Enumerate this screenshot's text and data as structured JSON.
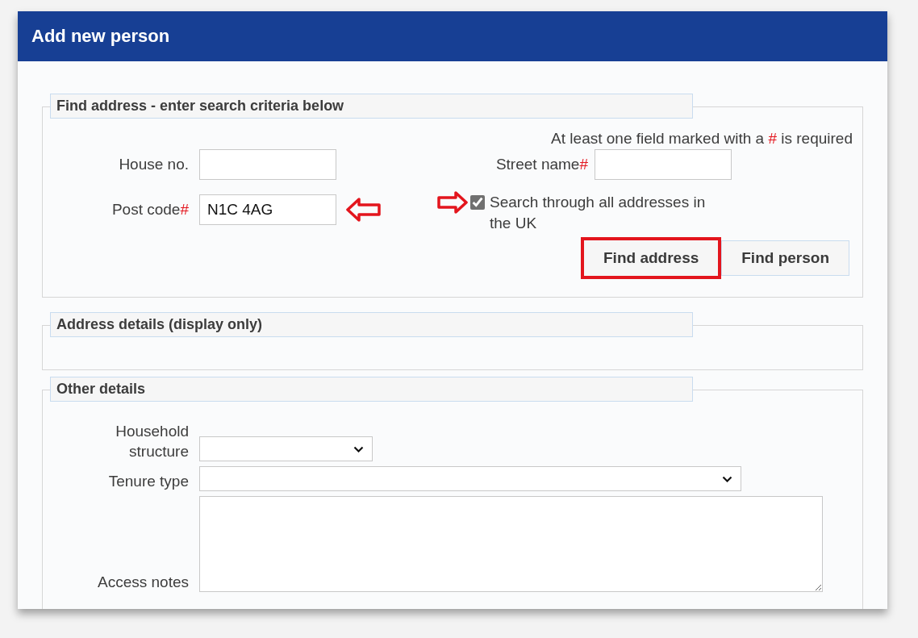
{
  "dialog": {
    "title": "Add new person"
  },
  "find_address": {
    "legend": "Find address - enter search criteria below",
    "note": {
      "before": "At least one field marked with a",
      "mark": "#",
      "after": "is required"
    },
    "house_no": {
      "label": "House no."
    },
    "street_name": {
      "label": "Street name",
      "required_mark": "#"
    },
    "post_code": {
      "label": "Post code",
      "required_mark": "#",
      "value": "N1C 4AG",
      "pointed": true
    },
    "search_all": {
      "label": "Search through all addresses in the UK",
      "checked": true,
      "pointed": true
    },
    "buttons": [
      {
        "label": "Find address",
        "highlighted": true
      },
      {
        "label": "Find person",
        "highlighted": false
      }
    ]
  },
  "address_details": {
    "legend": "Address details (display only)"
  },
  "other_details": {
    "legend": "Other details",
    "fields": [
      {
        "label": "Household structure",
        "kind": "short-select"
      },
      {
        "label": "Tenure type",
        "kind": "wide-select"
      },
      {
        "label": "Access notes",
        "kind": "notes"
      }
    ]
  }
}
